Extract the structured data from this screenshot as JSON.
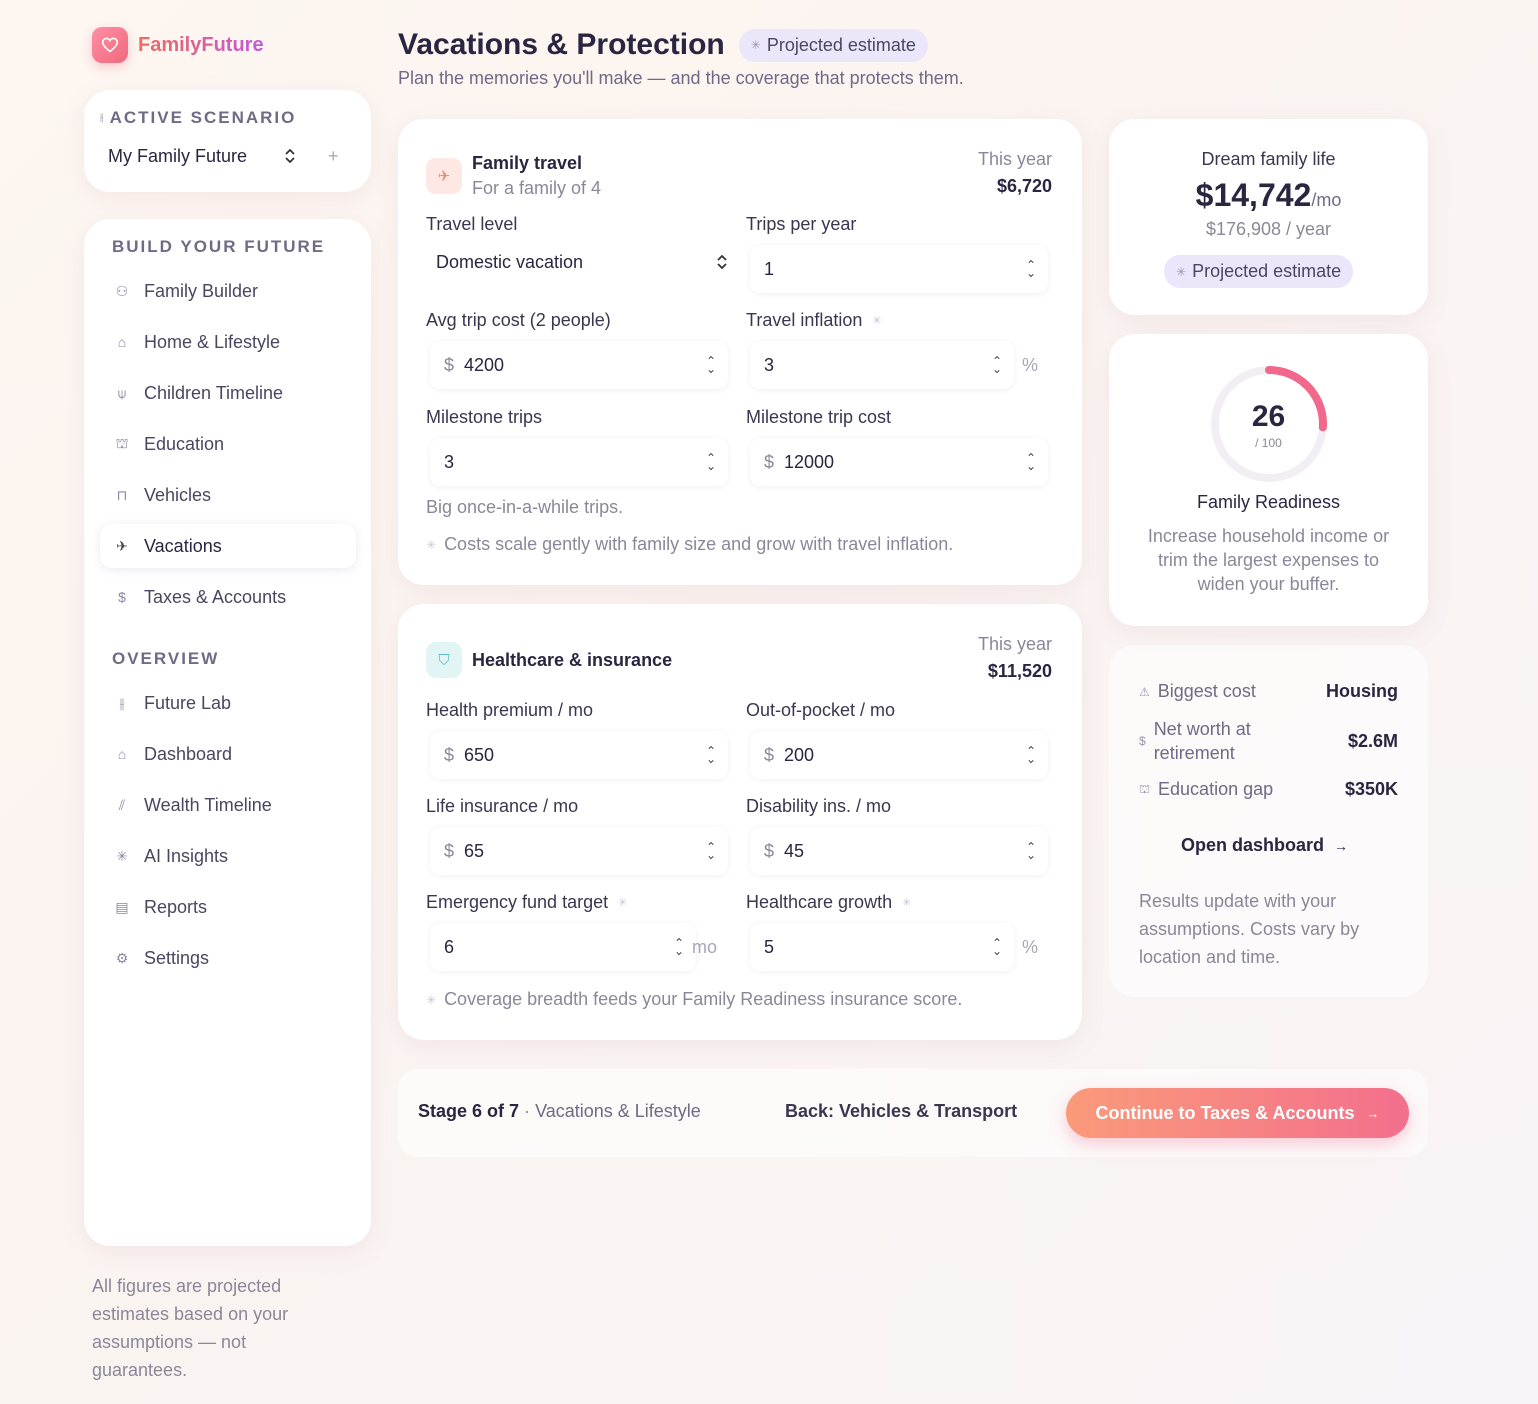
{
  "brand": {
    "name": "FamilyFuture",
    "logo_icon": "heart-icon"
  },
  "scenario": {
    "label": "ACTIVE SCENARIO",
    "selected": "My Family Future",
    "add_symbol": "+"
  },
  "nav": {
    "build_title": "BUILD YOUR FUTURE",
    "build_items": [
      {
        "label": "Family Builder",
        "icon": "people-icon"
      },
      {
        "label": "Home & Lifestyle",
        "icon": "home-icon"
      },
      {
        "label": "Children Timeline",
        "icon": "child-icon"
      },
      {
        "label": "Education",
        "icon": "graduation-cap-icon"
      },
      {
        "label": "Vehicles",
        "icon": "car-icon"
      },
      {
        "label": "Vacations",
        "icon": "plane-icon",
        "active": true
      },
      {
        "label": "Taxes & Accounts",
        "icon": "dollar-icon"
      }
    ],
    "overview_title": "OVERVIEW",
    "overview_items": [
      {
        "label": "Future Lab",
        "icon": "lab-icon"
      },
      {
        "label": "Dashboard",
        "icon": "house-icon"
      },
      {
        "label": "Wealth Timeline",
        "icon": "bar-chart-icon"
      },
      {
        "label": "AI Insights",
        "icon": "sparkle-icon"
      },
      {
        "label": "Reports",
        "icon": "document-icon"
      },
      {
        "label": "Settings",
        "icon": "gear-icon"
      }
    ]
  },
  "disclaimer": "All figures are projected estimates based on your assumptions — not guarantees.",
  "header": {
    "title": "Vacations & Protection",
    "badge": "Projected estimate",
    "subtitle": "Plan the memories you'll make — and the coverage that protects them."
  },
  "travel": {
    "title": "Family travel",
    "subtitle": "For a family of 4",
    "year_label": "This year",
    "year_value": "$6,720",
    "travel_level_label": "Travel level",
    "travel_level_value": "Domestic vacation",
    "trips_label": "Trips per year",
    "trips_value": "1",
    "avg_cost_label": "Avg trip cost (2 people)",
    "avg_cost_value": "4200",
    "inflation_label": "Travel inflation",
    "inflation_value": "3",
    "milestone_trips_label": "Milestone trips",
    "milestone_trips_value": "3",
    "milestone_cost_label": "Milestone trip cost",
    "milestone_cost_value": "12000",
    "milestone_helper": "Big once-in-a-while trips.",
    "note": "Costs scale gently with family size and grow with travel inflation."
  },
  "health": {
    "title": "Healthcare & insurance",
    "year_label": "This year",
    "year_value": "$11,520",
    "premium_label": "Health premium / mo",
    "premium_value": "650",
    "oop_label": "Out-of-pocket / mo",
    "oop_value": "200",
    "life_label": "Life insurance / mo",
    "life_value": "65",
    "disability_label": "Disability ins. / mo",
    "disability_value": "45",
    "emergency_label": "Emergency fund target",
    "emergency_value": "6",
    "emergency_unit": "mo",
    "growth_label": "Healthcare growth",
    "growth_value": "5",
    "note": "Coverage breadth feeds your Family Readiness insurance score."
  },
  "units": {
    "dollar": "$",
    "percent": "%"
  },
  "dream": {
    "label": "Dream family life",
    "value": "$14,742",
    "per": "/mo",
    "yearly": "$176,908 / year",
    "badge": "Projected estimate"
  },
  "readiness": {
    "score": "26",
    "score_value": 26,
    "max": "/ 100",
    "title": "Family Readiness",
    "description": "Increase household income or trim the largest expenses to widen your buffer.",
    "ring_color": "#f0688c"
  },
  "stats": {
    "biggest_label": "Biggest cost",
    "biggest_value": "Housing",
    "networth_label": "Net worth at retirement",
    "networth_value": "$2.6M",
    "edu_label": "Education gap",
    "edu_value": "$350K",
    "open_dashboard": "Open dashboard",
    "note": "Results update with your assumptions. Costs vary by location and time."
  },
  "footer": {
    "stage": "Stage 6 of 7",
    "stage_sep": "·",
    "stage_name": "Vacations & Lifestyle",
    "back": "Back: Vehicles & Transport",
    "continue": "Continue to Taxes & Accounts"
  }
}
